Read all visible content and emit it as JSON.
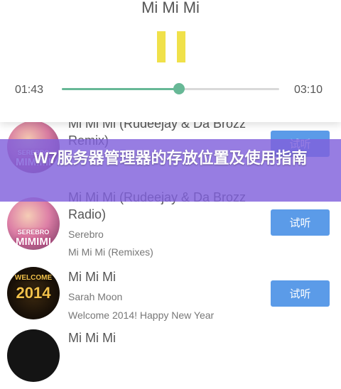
{
  "player": {
    "title": "Mi Mi Mi",
    "current_time": "01:43",
    "total_time": "03:10",
    "progress": 0.54
  },
  "songs": [
    {
      "title": "Mi Mi Mi (Rudeejay & Da Brozz Remix)",
      "artist": "Serebro",
      "album": "Mi Mi Mi (Remixes)",
      "art_text": "SEREBRO MIMIMI",
      "button": "试听"
    },
    {
      "title": "Mi Mi Mi (Rudeejay & Da Brozz Radio)",
      "artist": "Serebro",
      "album": "Mi Mi Mi (Remixes)",
      "art_text": "SEREBRO MIMIMI",
      "button": "试听"
    },
    {
      "title": "Mi Mi Mi",
      "artist": "Sarah Moon",
      "album": "Welcome 2014! Happy New Year",
      "art_text": "WELCOME 2014",
      "button": "试听"
    },
    {
      "title": "Mi Mi Mi",
      "artist": "",
      "album": "",
      "art_text": "",
      "button": ""
    }
  ],
  "banner": {
    "text": "W7服务器管理器的存放位置及使用指南"
  },
  "colors": {
    "accent_green": "#67b896",
    "pause_yellow": "#f0e14a",
    "button_blue": "#5b9be8",
    "banner_purple": "#8060dc"
  }
}
